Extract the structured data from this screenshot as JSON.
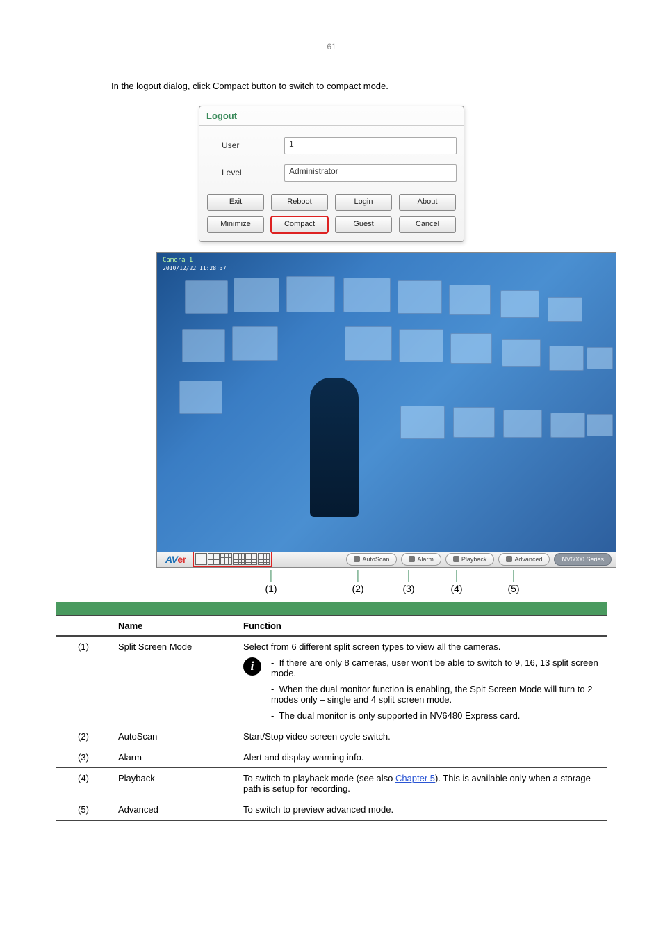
{
  "page_number": "61",
  "intro_para": "In the logout dialog, click Compact button to switch to compact mode.",
  "logout": {
    "title": "Logout",
    "user_label": "User",
    "user_value": "1",
    "level_label": "Level",
    "level_value": "Administrator",
    "buttons_row1": [
      "Exit",
      "Reboot",
      "Login",
      "About"
    ],
    "buttons_row2": [
      "Minimize",
      "Compact",
      "Guest",
      "Cancel"
    ]
  },
  "camera": {
    "cam_label": "Camera 1",
    "timestamp": "2010/12/22 11:28:37",
    "logo_prefix": "AV",
    "logo_suffix": "er",
    "bar_buttons": [
      "AutoScan",
      "Alarm",
      "Playback",
      "Advanced"
    ],
    "series_label": "NV6000 Series"
  },
  "callouts": {
    "c1": "(1)",
    "c2": "(2)",
    "c3": "(3)",
    "c4": "(4)",
    "c5": "(5)"
  },
  "table": {
    "col_name": "Name",
    "col_func": "Function",
    "rows": [
      {
        "num": "(1)",
        "name": "Split Screen Mode",
        "func_line1": "Select from 6 different split screen types to view all the cameras.",
        "info_p1_a": "If there are only 8 cameras, user ",
        "info_p1_b": "won't be able to switch to 9, 16, 13",
        "info_p1_c": " split screen mode.",
        "info_p2": "When the dual monitor function is enabling, the Spit Screen Mode will turn to 2 modes only – single and 4 split screen mode.",
        "info_p3": "The dual monitor is only supported in NV6480 Express card."
      },
      {
        "num": "(2)",
        "name": "AutoScan",
        "func": "Start/Stop video screen cycle switch."
      },
      {
        "num": "(3)",
        "name": "Alarm",
        "func": "Alert and display warning info."
      },
      {
        "num": "(4)",
        "name": "Playback",
        "func_a": "To switch to playback mode (see also ",
        "link": "Chapter 5",
        "func_b": "). This is available only when a storage path is setup for recording."
      },
      {
        "num": "(5)",
        "name": "Advanced",
        "func": "To switch to preview advanced mode."
      }
    ]
  }
}
